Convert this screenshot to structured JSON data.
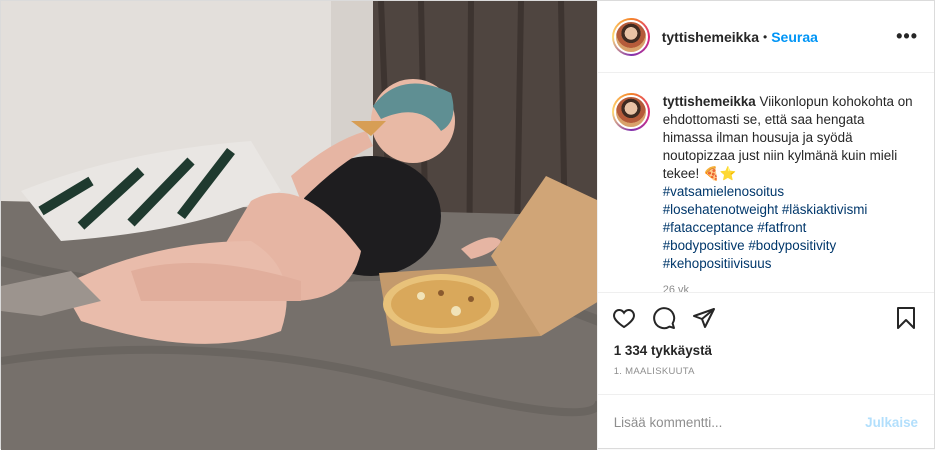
{
  "header": {
    "username": "tyttishemeikka",
    "separator": "•",
    "follow_label": "Seuraa",
    "more_label": "•••"
  },
  "caption": {
    "username": "tyttishemeikka",
    "text": "Viikonlopun kohokohta on ehdottomasti se, että saa hengata himassa ilman housuja ja syödä noutopizzaa just niin kylmänä kuin mieli tekee!",
    "emojis": "🍕⭐",
    "hashtags": [
      "#vatsamielenosoitus",
      "#losehatenotweight #läskiaktivismi",
      "#fatacceptance #fatfront",
      "#bodypositive #bodypositivity",
      "#kehopositiivisuus"
    ],
    "time": "26 vk"
  },
  "actions": {
    "like_icon": "heart-icon",
    "comment_icon": "comment-icon",
    "share_icon": "share-icon",
    "save_icon": "bookmark-icon"
  },
  "likes": "1 334 tykkäystä",
  "date": "1. MAALISKUUTA",
  "comment": {
    "placeholder": "Lisää kommentti...",
    "publish_label": "Julkaise"
  },
  "colors": {
    "link_blue": "#0095f6",
    "hashtag": "#00376b",
    "muted": "#8e8e8e",
    "publish_disabled": "#b2dffc"
  }
}
